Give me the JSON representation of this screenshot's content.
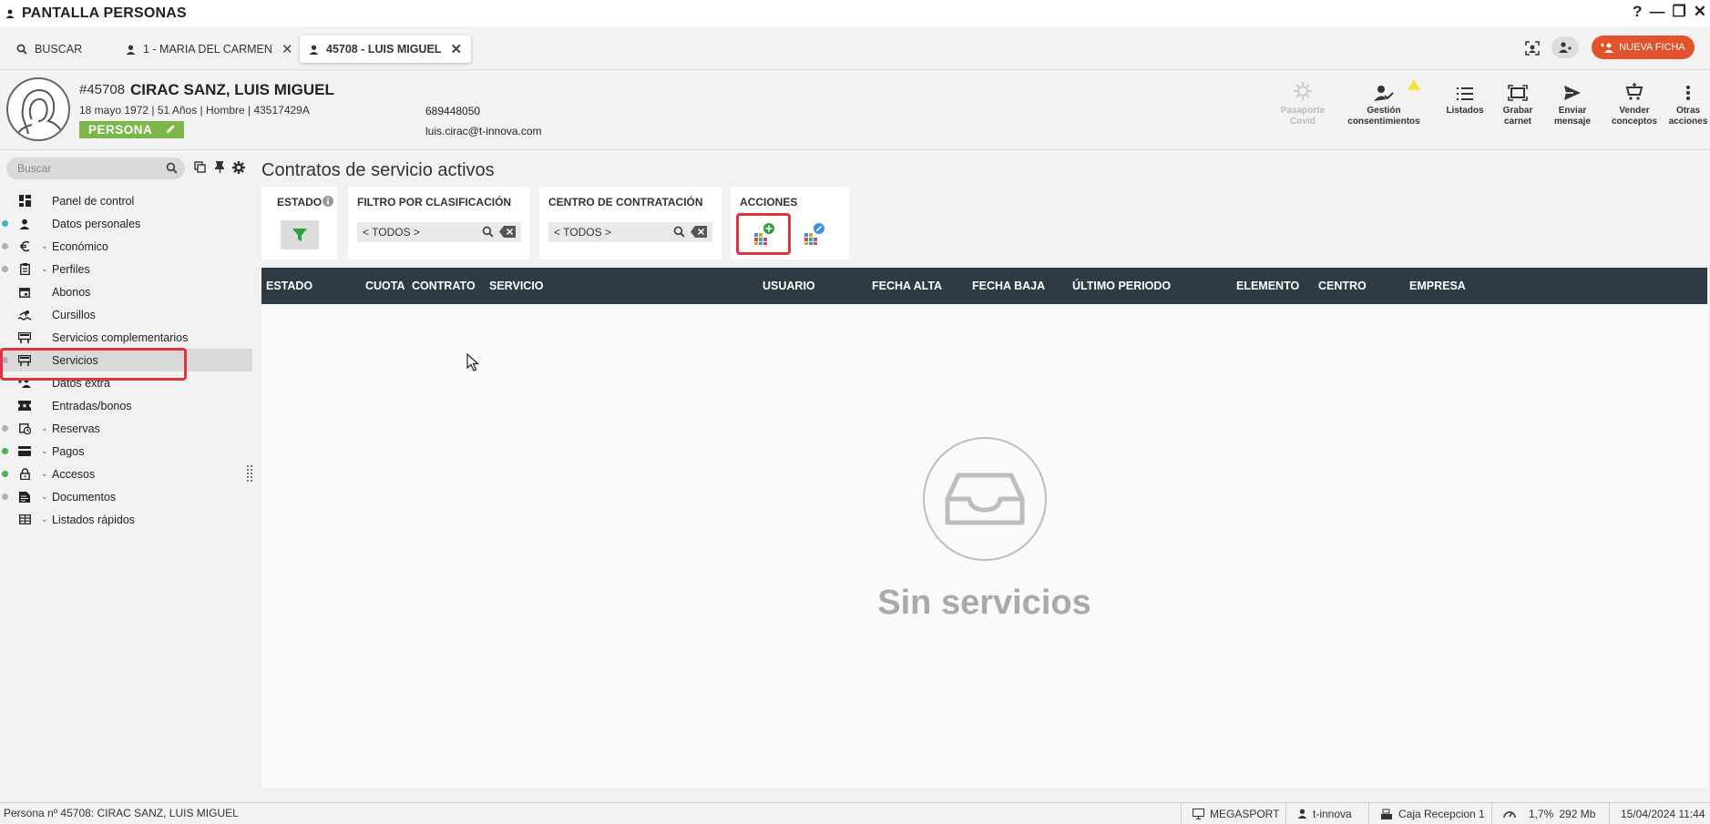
{
  "window": {
    "title": "PANTALLA PERSONAS",
    "controls": [
      "?",
      "—",
      "❐",
      "✕"
    ]
  },
  "tabs": [
    {
      "label": "BUSCAR"
    },
    {
      "label": "1 - MARIA DEL CARMEN"
    },
    {
      "label": "45708 - LUIS MIGUEL"
    }
  ],
  "topbar": {
    "new_button": "NUEVA FICHA"
  },
  "person": {
    "id": "#45708",
    "name": "CIRAC SANZ, LUIS MIGUEL",
    "info": "18 mayo 1972 | 51 Años | Hombre | 43517429A",
    "type": "PERSONA",
    "phone": "689448050",
    "email": "luis.cirac@t-innova.com"
  },
  "header_actions": [
    {
      "line1": "Pasaporte",
      "line2": "Covid",
      "icon": "virus-icon",
      "disabled": true
    },
    {
      "line1": "Gestión",
      "line2": "consentimientos",
      "icon": "user-check-icon",
      "warning": true
    },
    {
      "line1": "Listados",
      "line2": "",
      "icon": "list-icon"
    },
    {
      "line1": "Grabar",
      "line2": "carnet",
      "icon": "card-icon"
    },
    {
      "line1": "Enviar",
      "line2": "mensaje",
      "icon": "send-icon"
    },
    {
      "line1": "Vender",
      "line2": "conceptos",
      "icon": "cart-icon"
    },
    {
      "line1": "Otras",
      "line2": "acciones",
      "icon": "more-icon"
    }
  ],
  "sidebar": {
    "search_placeholder": "Buscar",
    "items": [
      {
        "label": "Panel de control",
        "icon": "dashboard-icon",
        "dot": "",
        "chevron": false
      },
      {
        "label": "Datos personales",
        "icon": "person-icon",
        "dot": "#3bb3c3",
        "chevron": false
      },
      {
        "label": "Económico",
        "icon": "euro-icon",
        "dot": "#b0b0b0",
        "chevron": true
      },
      {
        "label": "Perfiles",
        "icon": "clipboard-icon",
        "dot": "#b0b0b0",
        "chevron": true
      },
      {
        "label": "Abonos",
        "icon": "calendar-icon",
        "dot": "",
        "chevron": false
      },
      {
        "label": "Cursillos",
        "icon": "swim-icon",
        "dot": "",
        "chevron": false
      },
      {
        "label": "Servicios complementarios",
        "icon": "service-icon",
        "dot": "",
        "chevron": false
      },
      {
        "label": "Servicios",
        "icon": "service-icon",
        "dot": "#b0b0b0",
        "chevron": false,
        "selected": true
      },
      {
        "label": "Datos extra",
        "icon": "person-add-icon",
        "dot": "",
        "chevron": false
      },
      {
        "label": "Entradas/bonos",
        "icon": "ticket-icon",
        "dot": "",
        "chevron": false
      },
      {
        "label": "Reservas",
        "icon": "calendar-clock-icon",
        "dot": "#b0b0b0",
        "chevron": true
      },
      {
        "label": "Pagos",
        "icon": "credit-card-icon",
        "dot": "#4caf50",
        "chevron": true
      },
      {
        "label": "Accesos",
        "icon": "lock-icon",
        "dot": "#4caf50",
        "chevron": true
      },
      {
        "label": "Documentos",
        "icon": "document-icon",
        "dot": "#b0b0b0",
        "chevron": true
      },
      {
        "label": "Listados rápidos",
        "icon": "table-icon",
        "dot": "",
        "chevron": true
      }
    ]
  },
  "main": {
    "title": "Contratos de servicio activos",
    "filters": {
      "estado_label": "ESTADO",
      "clasificacion_label": "FILTRO POR CLASIFICACIÓN",
      "clasificacion_value": "< TODOS >",
      "centro_label": "CENTRO DE CONTRATACIÓN",
      "centro_value": "< TODOS >",
      "acciones_label": "ACCIONES"
    },
    "columns": [
      "ESTADO",
      "CUOTA",
      "CONTRATO",
      "SERVICIO",
      "USUARIO",
      "FECHA ALTA",
      "FECHA BAJA",
      "ÚLTIMO PERIODO",
      "ELEMENTO",
      "CENTRO",
      "EMPRESA"
    ],
    "empty_text": "Sin servicios"
  },
  "statusbar": {
    "left": "Persona nº 45708: CIRAC SANZ, LUIS MIGUEL",
    "site": "MEGASPORT",
    "user": "t-innova",
    "cash": "Caja Recepcion 1",
    "cpu": "1,7%",
    "mem": "292 Mb",
    "datetime": "15/04/2024 11:44"
  },
  "colors": {
    "accent": "#e2522b",
    "persona_badge": "#7ab648",
    "grid_header": "#2e3b45",
    "highlight": "#e0333b"
  }
}
